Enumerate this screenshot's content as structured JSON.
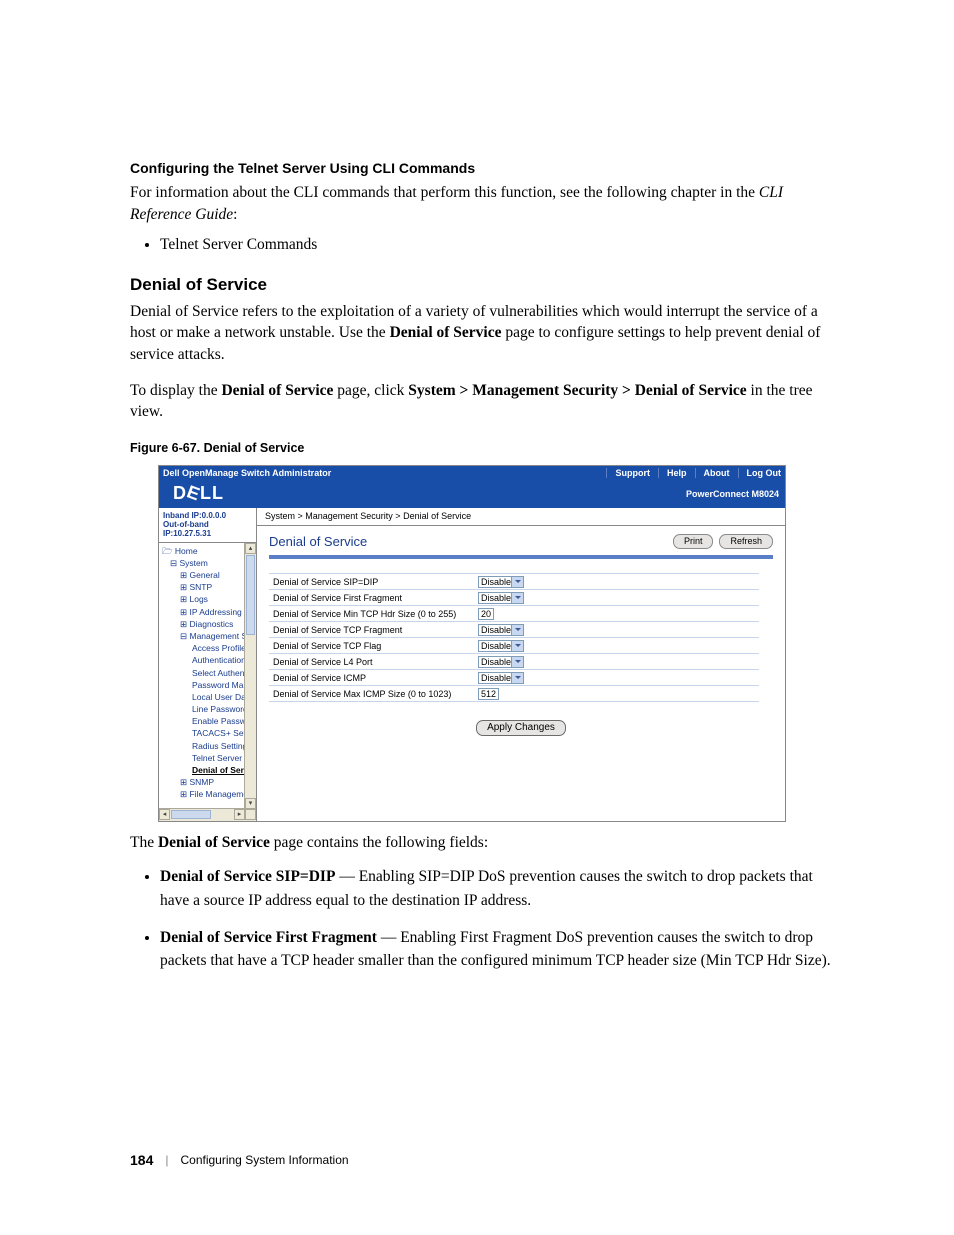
{
  "heading1": "Configuring the Telnet Server Using CLI Commands",
  "intro1a": "For information about the CLI commands that perform this function, see the following chapter in the ",
  "intro1b": "CLI Reference Guide",
  "intro1c": ":",
  "bullet_a": "Telnet Server Commands",
  "section_head": "Denial of Service",
  "para1a": "Denial of Service refers to the exploitation of a variety of vulnerabilities which would interrupt the service of a host or make a network unstable. Use the ",
  "para1b": "Denial of Service",
  "para1c": " page to configure settings to help prevent denial of service attacks.",
  "para2a": "To display the ",
  "para2b": "Denial of Service",
  "para2c": " page, click ",
  "para2d": "System > Management Security > Denial of Service",
  "para2e": " in the tree view.",
  "fig_caption": "Figure 6-67.    Denial of Service",
  "shot": {
    "top_title": "Dell OpenManage Switch Administrator",
    "nav": [
      "Support",
      "Help",
      "About",
      "Log Out"
    ],
    "logo": "D&#9166;LL",
    "product": "PowerConnect M8024",
    "ip1": "Inband IP:0.0.0.0",
    "ip2": "Out-of-band IP:10.27.5.31",
    "crumb": "System > Management Security > Denial of Service",
    "main_title": "Denial of Service",
    "btn_print": "Print",
    "btn_refresh": "Refresh",
    "tree": {
      "home": "Home",
      "system": "System",
      "general": "General",
      "sntp": "SNTP",
      "logs": "Logs",
      "ipaddr": "IP Addressing",
      "diag": "Diagnostics",
      "mgmtsec": "Management Secur",
      "access": "Access Profiles",
      "authp": "Authentication P",
      "selauth": "Select Authentic",
      "pwdman": "Password Mana",
      "luserdb": "Local User Data",
      "linepwd": "Line Password",
      "enpwd": "Enable Passwor",
      "tacacs": "TACACS+ Settin",
      "radius": "Radius Settings",
      "telnet": "Telnet Server",
      "dos": "Denial of Servi",
      "snmp": "SNMP",
      "filem": "File Management"
    },
    "rows": [
      {
        "label": "Denial of Service SIP=DIP",
        "ctl": "select",
        "val": "Disable"
      },
      {
        "label": "Denial of Service First Fragment",
        "ctl": "select",
        "val": "Disable"
      },
      {
        "label": "Denial of Service Min TCP Hdr Size (0 to 255)",
        "ctl": "input",
        "val": "20"
      },
      {
        "label": "Denial of Service TCP Fragment",
        "ctl": "select",
        "val": "Disable"
      },
      {
        "label": "Denial of Service TCP Flag",
        "ctl": "select",
        "val": "Disable"
      },
      {
        "label": "Denial of Service L4 Port",
        "ctl": "select",
        "val": "Disable"
      },
      {
        "label": "Denial of Service ICMP",
        "ctl": "select",
        "val": "Disable"
      },
      {
        "label": "Denial of Service Max ICMP Size (0 to 1023)",
        "ctl": "input",
        "val": "512"
      }
    ],
    "apply": "Apply Changes"
  },
  "after1a": "The ",
  "after1b": "Denial of Service",
  "after1c": " page contains the following fields:",
  "bullets2": [
    {
      "b": "Denial of Service SIP=DIP",
      "t": " — Enabling SIP=DIP DoS prevention causes the switch to drop packets that have a source IP address equal to the destination IP address."
    },
    {
      "b": "Denial of Service First Fragment",
      "t": " — Enabling First Fragment DoS prevention causes the switch to drop packets that have a TCP header smaller than the configured minimum TCP header size (Min TCP Hdr Size)."
    }
  ],
  "footer_page": "184",
  "footer_text": "Configuring System Information"
}
